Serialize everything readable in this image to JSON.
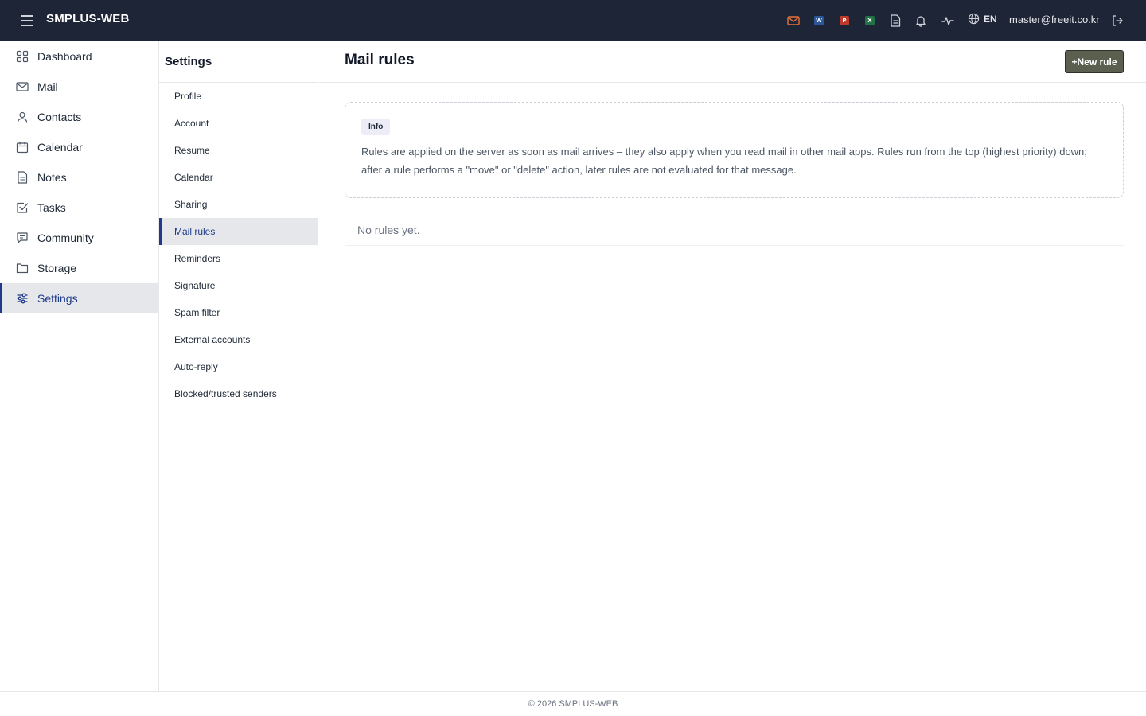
{
  "app": {
    "brand": "SMPLUS-WEB"
  },
  "header": {
    "icons": [
      {
        "name": "mail-icon",
        "color": "#e8743b"
      },
      {
        "name": "word-icon",
        "letter": "W",
        "color": "#2b579a"
      },
      {
        "name": "powerpoint-icon",
        "letter": "P",
        "color": "#c0392b"
      },
      {
        "name": "excel-icon",
        "letter": "X",
        "color": "#217346"
      },
      {
        "name": "document-icon"
      },
      {
        "name": "bell-icon"
      },
      {
        "name": "activity-icon"
      },
      {
        "name": "globe-icon"
      },
      {
        "name": "logout-icon"
      }
    ],
    "language": "EN",
    "user_email": "master@freeit.co.kr"
  },
  "sidebar": {
    "items": [
      {
        "label": "Dashboard",
        "icon": "grid-icon"
      },
      {
        "label": "Mail",
        "icon": "envelope-icon"
      },
      {
        "label": "Contacts",
        "icon": "person-icon"
      },
      {
        "label": "Calendar",
        "icon": "calendar-icon"
      },
      {
        "label": "Notes",
        "icon": "note-icon"
      },
      {
        "label": "Tasks",
        "icon": "task-check-icon"
      },
      {
        "label": "Community",
        "icon": "chat-icon"
      },
      {
        "label": "Storage",
        "icon": "folder-icon"
      },
      {
        "label": "Settings",
        "icon": "sliders-icon",
        "active": true
      }
    ]
  },
  "settings_nav": {
    "title": "Settings",
    "items": [
      {
        "label": "Profile"
      },
      {
        "label": "Account"
      },
      {
        "label": "Resume"
      },
      {
        "label": "Calendar"
      },
      {
        "label": "Sharing"
      },
      {
        "label": "Mail rules",
        "active": true
      },
      {
        "label": "Reminders"
      },
      {
        "label": "Signature"
      },
      {
        "label": "Spam filter"
      },
      {
        "label": "External accounts"
      },
      {
        "label": "Auto-reply"
      },
      {
        "label": "Blocked/trusted senders"
      }
    ]
  },
  "main": {
    "title": "Mail rules",
    "new_rule_label": "+New rule",
    "info": {
      "tag": "Info",
      "text": "Rules are applied on the server as soon as mail arrives – they also apply when you read mail in other mail apps. Rules run from the top (highest priority) down; after a rule performs a \"move\" or \"delete\" action, later rules are not evaluated for that message."
    },
    "empty_text": "No rules yet."
  },
  "footer": {
    "text": "© 2026 SMPLUS-WEB"
  },
  "colors": {
    "topbar_bg": "#1e2536",
    "active_accent": "#1f3a8a",
    "active_bg": "#e5e7eb",
    "button_bg": "#5b5f4f"
  }
}
